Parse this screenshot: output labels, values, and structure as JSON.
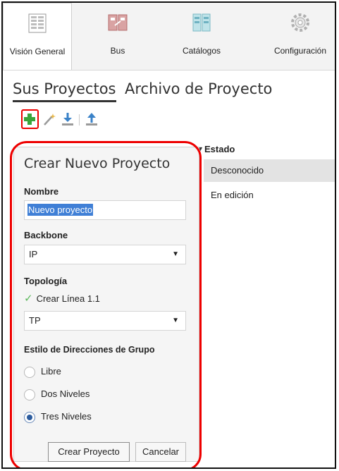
{
  "ribbon": {
    "tabs": [
      {
        "label": "Visión General",
        "icon": "overview-icon"
      },
      {
        "label": "Bus",
        "icon": "bus-icon"
      },
      {
        "label": "Catálogos",
        "icon": "catalog-icon"
      },
      {
        "label": "Configuración",
        "icon": "gear-icon"
      }
    ],
    "active_tab": "Visión General"
  },
  "page_tabs": [
    {
      "label": "Sus Proyectos",
      "active": true
    },
    {
      "label": "Archivo de Proyecto",
      "active": false
    }
  ],
  "toolbar": {
    "icons": [
      "add-project-icon",
      "wand-icon",
      "import-icon",
      "export-icon"
    ],
    "add_color": "#3aa43a",
    "highlight_color": "#ee0000"
  },
  "grid": {
    "column_header": "Estado",
    "rows": [
      "Desconocido",
      "En edición"
    ]
  },
  "panel": {
    "title": "Crear Nuevo Proyecto",
    "name_label": "Nombre",
    "name_value": "Nuevo proyecto",
    "backbone_label": "Backbone",
    "backbone_value": "IP",
    "topology_label": "Topología",
    "topology_check_label": "Crear Línea 1.1",
    "topology_value": "TP",
    "group_addr_label": "Estilo de Direcciones de Grupo",
    "radio_options": [
      "Libre",
      "Dos Niveles",
      "Tres Niveles"
    ],
    "radio_selected": "Tres Niveles",
    "create_button": "Crear Proyecto",
    "cancel_button": "Cancelar"
  }
}
